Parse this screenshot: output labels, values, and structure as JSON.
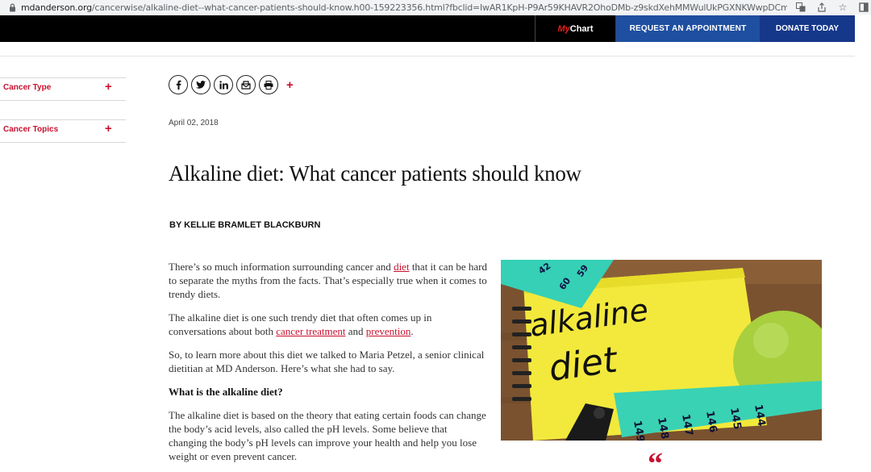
{
  "browser": {
    "url_host": "mdanderson.org",
    "url_path": "/cancerwise/alkaline-diet--what-cancer-patients-should-know.h00-159223356.html?fbclid=IwAR1KpH-P9Ar59KHAVR2OhoDMb-z9skdXehMMWulUkPGXNKWwpDCmZ..."
  },
  "header": {
    "mychart_my": "My",
    "mychart_chart": "Chart",
    "appointment_label": "REQUEST AN APPOINTMENT",
    "donate_label": "DONATE TODAY"
  },
  "sidebar": {
    "items": [
      {
        "label": "Cancer Type",
        "toggle": "+"
      },
      {
        "label": "Cancer Topics",
        "toggle": "+"
      }
    ]
  },
  "share": {
    "icons": [
      "facebook-icon",
      "twitter-icon",
      "linkedin-icon",
      "email-icon",
      "print-icon"
    ],
    "more": "+"
  },
  "article": {
    "date": "April 02, 2018",
    "title": "Alkaline diet: What cancer patients should know",
    "byline": "BY KELLIE BRAMLET BLACKBURN",
    "p1_before": "There’s so much information surrounding cancer and ",
    "p1_link": "diet",
    "p1_after": " that it can be hard to separate the myths from the facts. That’s especially true when it comes to trendy diets.",
    "p2_before": "The alkaline diet is one such trendy diet that often comes up in conversations about both ",
    "p2_link1": "cancer treatment",
    "p2_mid": " and ",
    "p2_link2": "prevention",
    "p2_after": ".",
    "p3": "So, to learn more about this diet we talked to Maria Petzel, a senior clinical dietitian at MD Anderson. Here’s what she had to say.",
    "heading": "What is the alkaline diet?",
    "p4": "The alkaline diet is based on the theory that eating certain foods can change the body’s acid levels, also called the pH levels. Some believe that changing the body’s pH levels can improve your health and help you lose weight or even prevent cancer.",
    "photo_word1": "alkaline",
    "photo_word2": "diet",
    "quote_mark": "“"
  }
}
